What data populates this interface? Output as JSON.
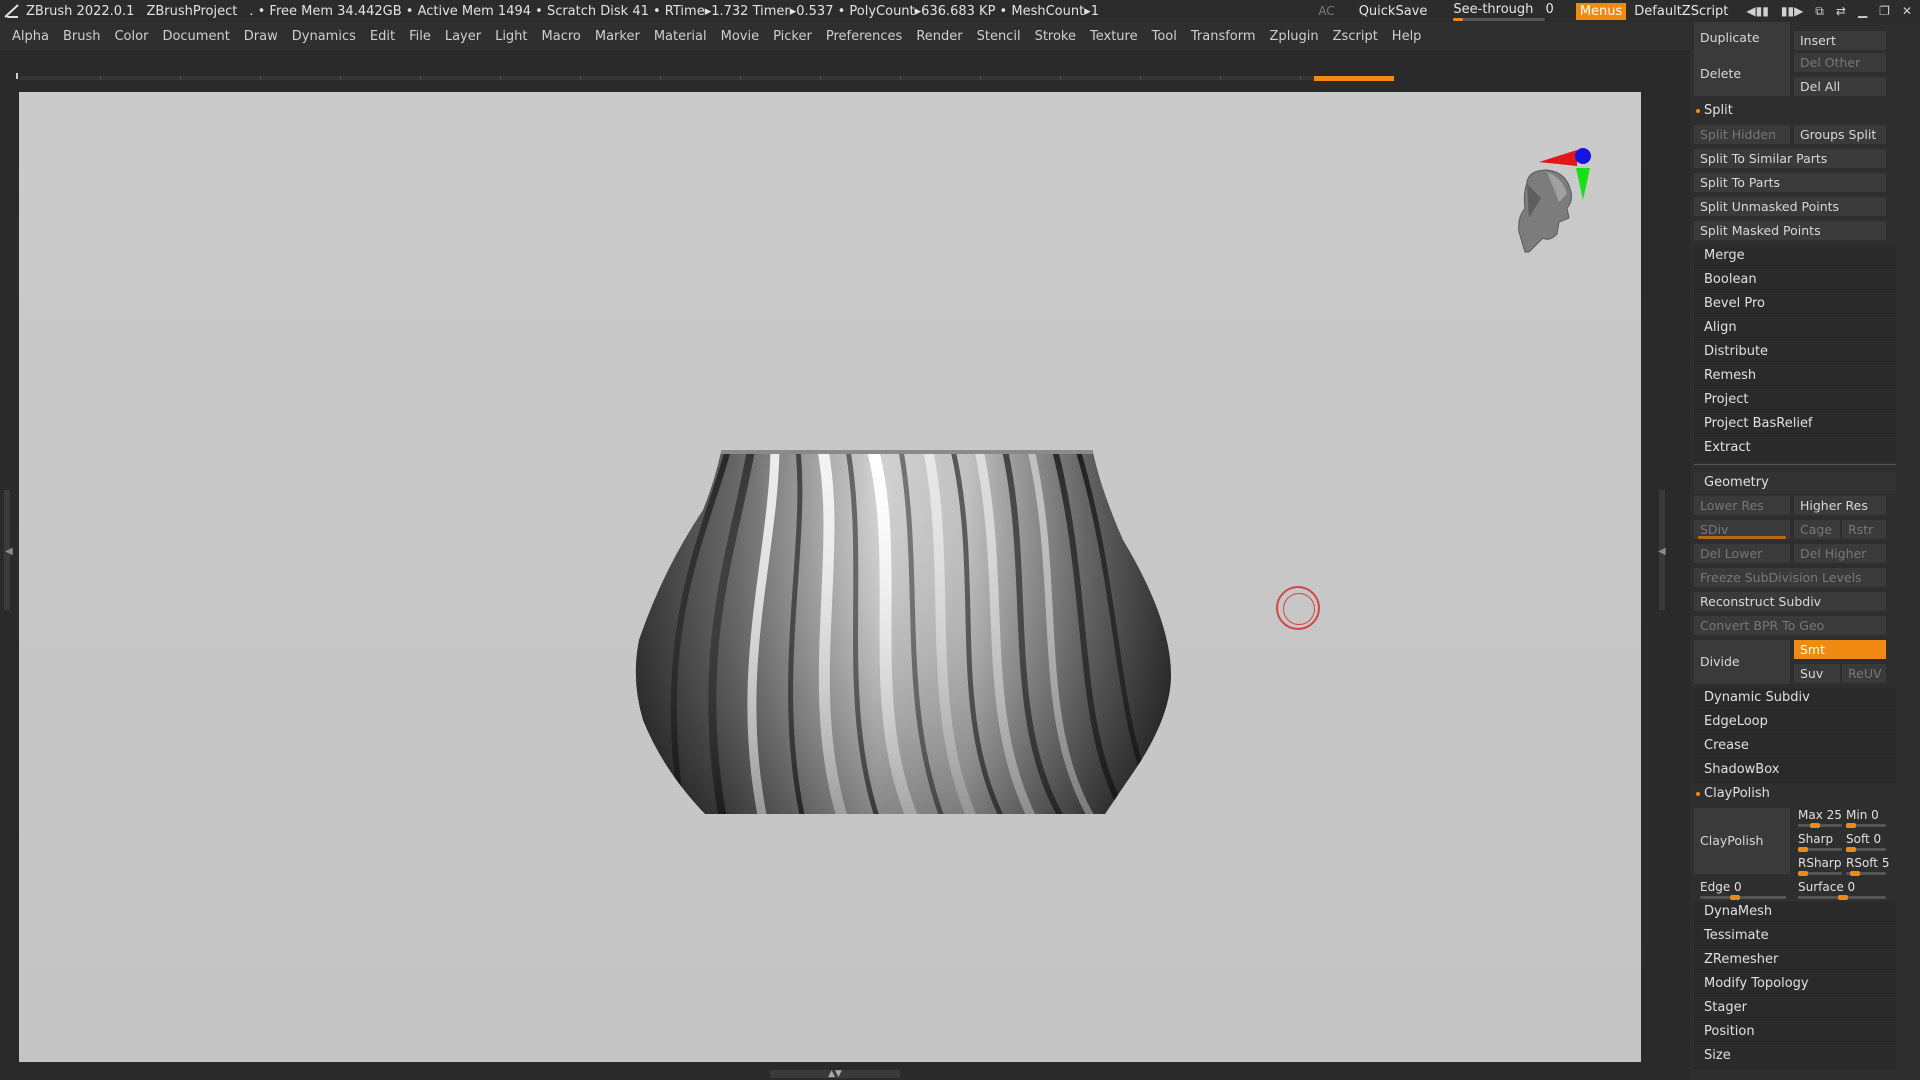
{
  "titlebar": {
    "app": "ZBrush 2022.0.1",
    "project": "ZBrushProject",
    "stats": ". • Free Mem 34.442GB • Active Mem 1494 • Scratch Disk 41 •  RTime▸1.732 Timer▸0.537 • PolyCount▸636.683 KP  • MeshCount▸1",
    "ac": "AC",
    "quicksave": "QuickSave",
    "seethrough": "See-through",
    "seethrough_value": "0",
    "menus": "Menus",
    "default_zscript": "DefaultZScript"
  },
  "menubar": {
    "items": [
      "Alpha",
      "Brush",
      "Color",
      "Document",
      "Draw",
      "Dynamics",
      "Edit",
      "File",
      "Layer",
      "Light",
      "Macro",
      "Marker",
      "Material",
      "Movie",
      "Picker",
      "Preferences",
      "Render",
      "Stencil",
      "Stroke",
      "Texture",
      "Tool",
      "Transform",
      "Zplugin",
      "Zscript",
      "Help"
    ]
  },
  "palette": {
    "duplicate": "Duplicate",
    "insert": "Insert",
    "delete": "Delete",
    "del_other": "Del Other",
    "del_all": "Del All",
    "split": "Split",
    "split_hidden": "Split Hidden",
    "groups_split": "Groups Split",
    "split_similar": "Split To Similar Parts",
    "split_parts": "Split To Parts",
    "split_unmasked": "Split Unmasked Points",
    "split_masked": "Split Masked Points",
    "merge": "Merge",
    "boolean": "Boolean",
    "bevel_pro": "Bevel Pro",
    "align": "Align",
    "distribute": "Distribute",
    "remesh": "Remesh",
    "project": "Project",
    "project_basrelief": "Project BasRelief",
    "extract": "Extract",
    "geometry": "Geometry",
    "lower_res": "Lower Res",
    "higher_res": "Higher Res",
    "sdiv": "SDiv",
    "cage": "Cage",
    "rstr": "Rstr",
    "del_lower": "Del Lower",
    "del_higher": "Del Higher",
    "freeze_subdiv": "Freeze SubDivision Levels",
    "reconstruct_subdiv": "Reconstruct Subdiv",
    "convert_bpr": "Convert BPR To Geo",
    "divide": "Divide",
    "smt": "Smt",
    "suv": "Suv",
    "reuv": "ReUV",
    "dynamic_subdiv": "Dynamic Subdiv",
    "edgeloop": "EdgeLoop",
    "crease": "Crease",
    "shadowbox": "ShadowBox",
    "claypolish_header": "ClayPolish",
    "claypolish_btn": "ClayPolish",
    "max_label": "Max 25",
    "max_value": 25,
    "min_label": "Min 0",
    "min_value": 0,
    "sharp_label": "Sharp",
    "soft_label": "Soft 0",
    "rsharp_label": "RSharp",
    "rsoft_label": "RSoft 5",
    "edge_label": "Edge 0",
    "surface_label": "Surface 0",
    "dynamesh": "DynaMesh",
    "tessimate": "Tessimate",
    "zremesher": "ZRemesher",
    "modify_topology": "Modify Topology",
    "stager": "Stager",
    "position": "Position",
    "size": "Size"
  },
  "colors": {
    "accent": "#f08a12",
    "canvas_bg": "#c8c8c8",
    "ui_bg": "#2a2a2a",
    "button_bg": "#3a3a3a",
    "cursor_ring": "#d04646"
  }
}
